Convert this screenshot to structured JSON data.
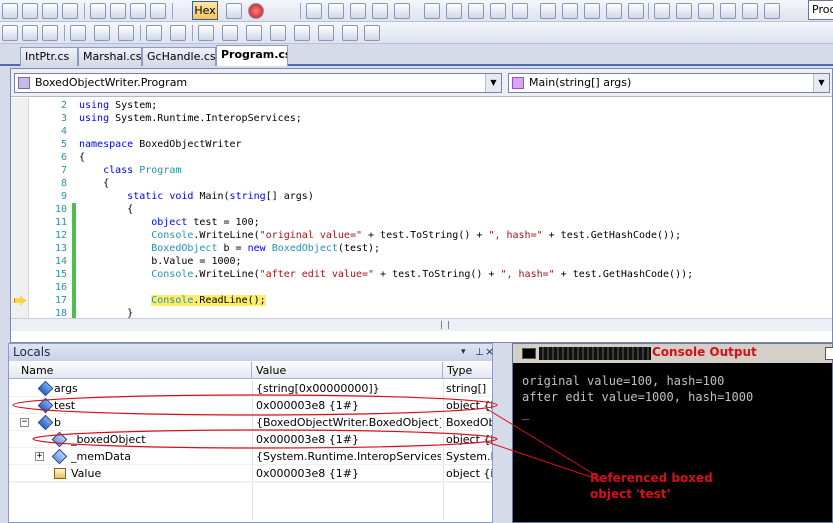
{
  "toolbar": {
    "hex_label": "Hex",
    "process_label": "Proc"
  },
  "tabs": [
    {
      "label": "IntPtr.cs"
    },
    {
      "label": "Marshal.cs"
    },
    {
      "label": "GcHandle.cs"
    },
    {
      "label": "Program.cs"
    }
  ],
  "editor": {
    "type_combo": "BoxedObjectWriter.Program",
    "member_combo": "Main(string[] args)",
    "line_numbers": [
      "2",
      "3",
      "4",
      "5",
      "6",
      "7",
      "8",
      "9",
      "10",
      "11",
      "12",
      "13",
      "14",
      "15",
      "16",
      "17",
      "18"
    ]
  },
  "locals": {
    "title": "Locals",
    "columns": [
      "Name",
      "Value",
      "Type"
    ],
    "rows": [
      {
        "name": "args",
        "value": "{string[0x00000000]}",
        "type": "string[]"
      },
      {
        "name": "test",
        "value": "0x000003e8 {1#}",
        "type": "object {in"
      },
      {
        "name": "b",
        "value": "{BoxedObjectWriter.BoxedObject}",
        "type": "BoxedObj"
      },
      {
        "name": "_boxedObject",
        "value": "0x000003e8 {1#}",
        "type": "object {in"
      },
      {
        "name": "_memData",
        "value": "{System.Runtime.InteropServices.GCH",
        "type": "System.R"
      },
      {
        "name": "Value",
        "value": "0x000003e8 {1#}",
        "type": "object {in"
      }
    ]
  },
  "console": {
    "title": "Console Output",
    "lines": [
      "original value=100, hash=100",
      "after edit value=1000, hash=1000",
      "_"
    ]
  },
  "annotation": {
    "line1": "Referenced boxed",
    "line2": "object 'test'"
  },
  "colors": {
    "annotation": "#d60f1a",
    "current_line_highlight": "#ffee62",
    "keyword": "#0000ff",
    "type_name": "#2b91af",
    "string": "#a31515"
  }
}
